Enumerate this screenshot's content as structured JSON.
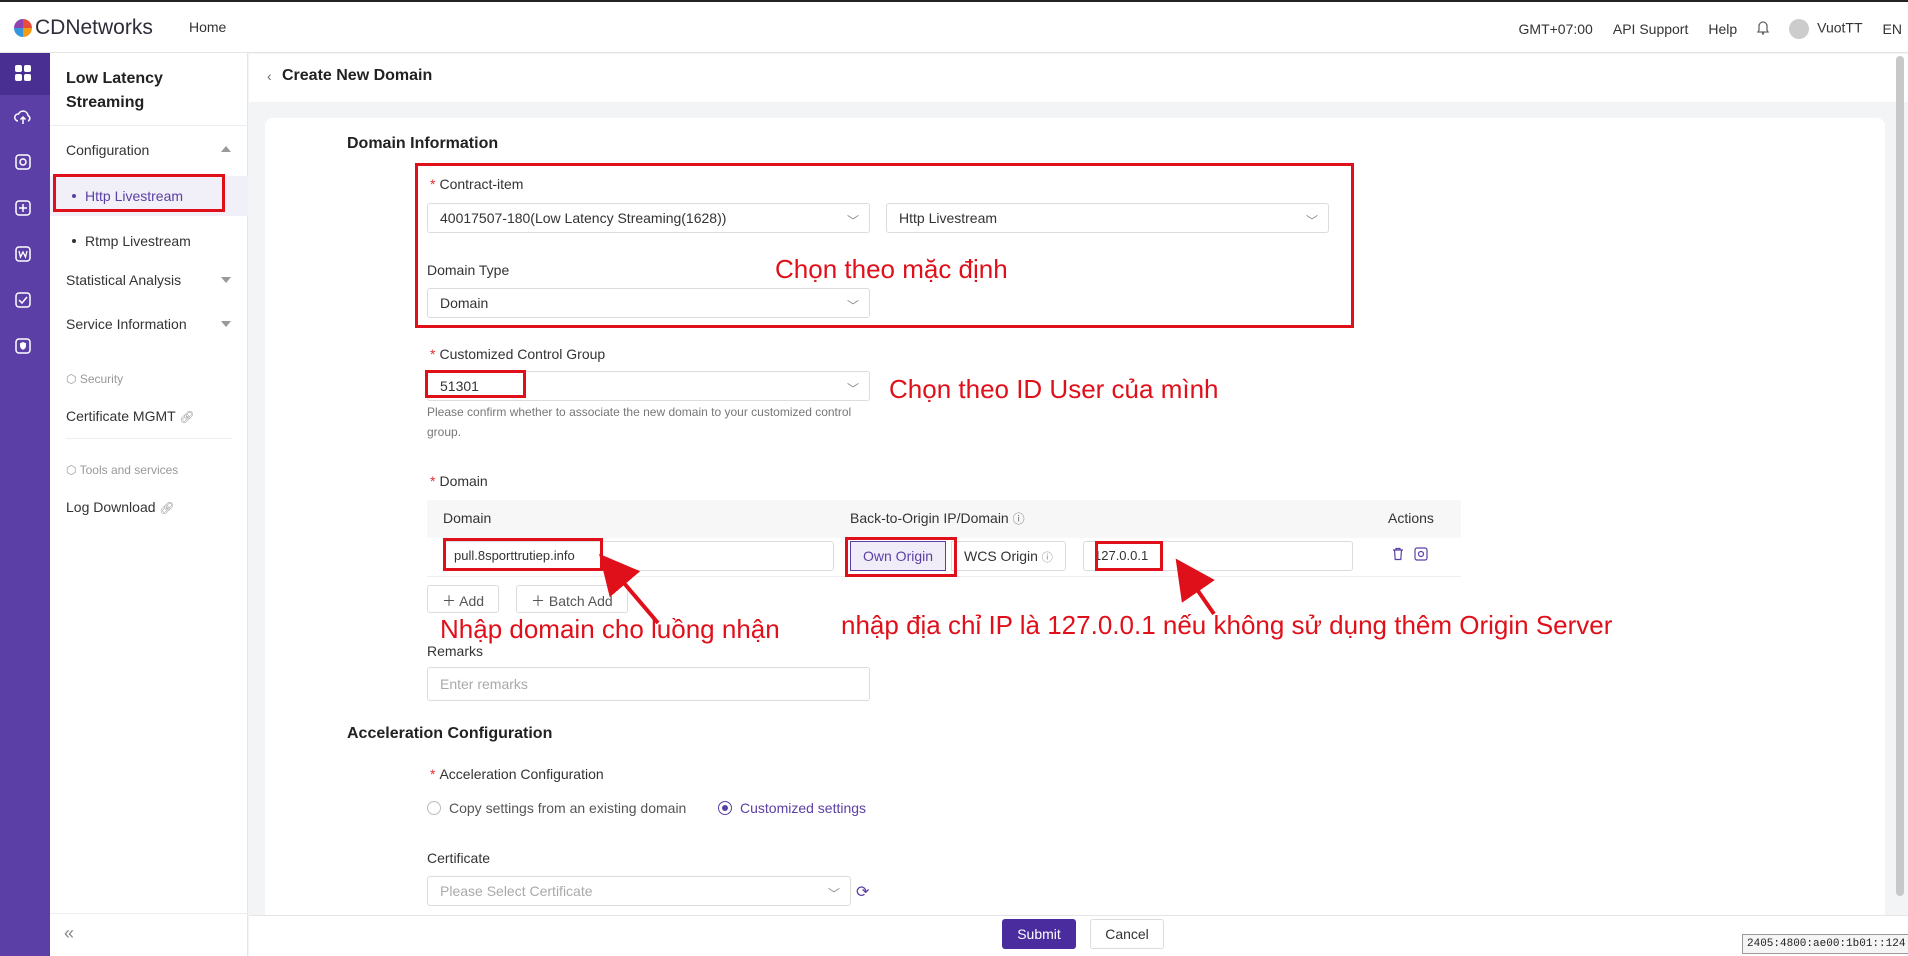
{
  "topbar": {
    "logo_text": "CDNetworks",
    "home": "Home",
    "timezone": "GMT+07:00",
    "api_support": "API Support",
    "help": "Help",
    "user": "VuotTT",
    "lang": "EN"
  },
  "sidebar": {
    "title": "Low Latency Streaming",
    "configuration": "Configuration",
    "http_livestream": "Http Livestream",
    "rtmp_livestream": "Rtmp Livestream",
    "statistical_analysis": "Statistical Analysis",
    "service_information": "Service Information",
    "security_group": "Security",
    "certificate_mgmt": "Certificate MGMT",
    "tools_group": "Tools and services",
    "log_download": "Log Download"
  },
  "page": {
    "title": "Create New Domain"
  },
  "domain_info": {
    "section_title": "Domain Information",
    "contract_label": "Contract-item",
    "contract_value": "40017507-180(Low Latency Streaming(1628))",
    "product_value": "Http Livestream",
    "domain_type_label": "Domain Type",
    "domain_type_value": "Domain",
    "ccg_label": "Customized Control Group",
    "ccg_value": "51301",
    "ccg_help": "Please confirm whether to associate the new domain to your customized control group.",
    "domain_label": "Domain",
    "col_domain": "Domain",
    "col_origin": "Back-to-Origin IP/Domain",
    "col_actions": "Actions",
    "domain_value": "pull.8sporttrutiep.info",
    "own_origin": "Own Origin",
    "wcs_origin": "WCS Origin",
    "origin_value": "127.0.0.1",
    "add": "Add",
    "batch_add": "Batch Add",
    "remarks_label": "Remarks",
    "remarks_placeholder": "Enter remarks"
  },
  "acceleration": {
    "section_title": "Acceleration Configuration",
    "label": "Acceleration Configuration",
    "opt_copy": "Copy settings from an existing domain",
    "opt_custom": "Customized settings",
    "cert_label": "Certificate",
    "cert_placeholder": "Please Select Certificate"
  },
  "footer": {
    "submit": "Submit",
    "cancel": "Cancel",
    "ip": "2405:4800:ae00:1b01::124"
  },
  "annotations": {
    "default": "Chọn theo mặc định",
    "user_id": "Chọn theo ID User của mình",
    "enter_domain": "Nhập domain cho luồng nhận",
    "enter_ip": "nhập địa chỉ IP là 127.0.0.1 nếu không sử dụng thêm Origin Server"
  },
  "colors": {
    "brand": "#5b3fa6",
    "primary_button": "#4b2c9e",
    "annotation_red": "#e0101a"
  }
}
